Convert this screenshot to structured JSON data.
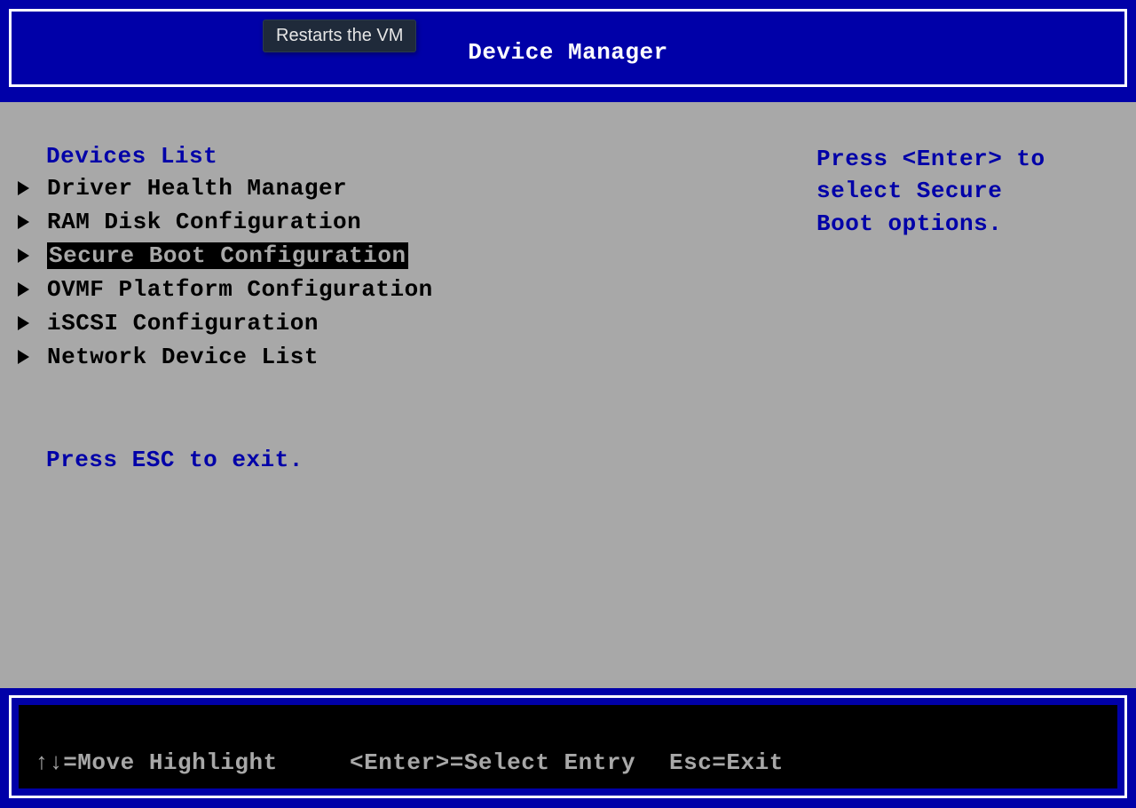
{
  "header": {
    "title": "Device Manager",
    "tooltip": "Restarts the VM"
  },
  "sidebar": {
    "section_title": "Devices List",
    "items": [
      {
        "label": "Driver Health Manager",
        "selected": false
      },
      {
        "label": "RAM Disk Configuration",
        "selected": false
      },
      {
        "label": "Secure Boot Configuration",
        "selected": true
      },
      {
        "label": "OVMF Platform Configuration",
        "selected": false
      },
      {
        "label": "iSCSI Configuration",
        "selected": false
      },
      {
        "label": "Network Device List",
        "selected": false
      }
    ],
    "exit_hint": "Press ESC to exit."
  },
  "help": {
    "text": "Press <Enter> to select Secure Boot options."
  },
  "footer": {
    "move": "↑↓=Move Highlight",
    "select": "<Enter>=Select Entry",
    "exit": "Esc=Exit"
  }
}
